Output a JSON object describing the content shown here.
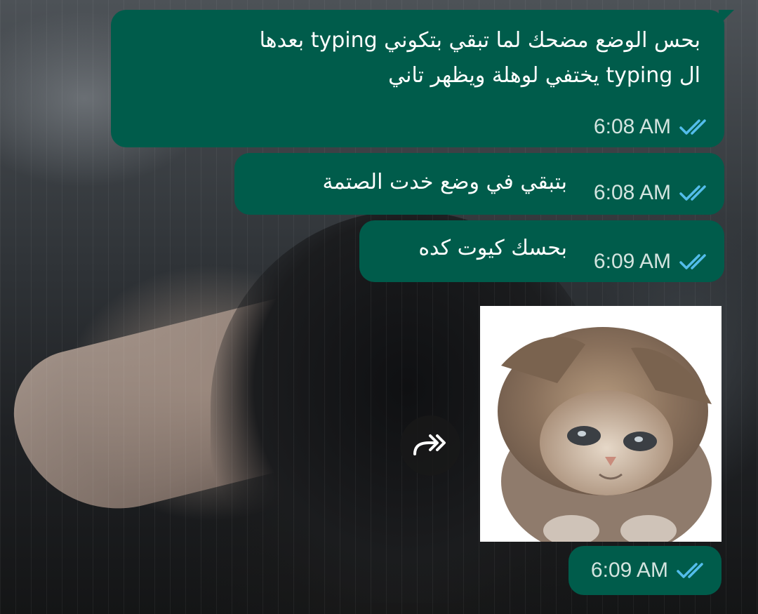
{
  "chat": {
    "messages": [
      {
        "text_lines": [
          "بحس الوضع مضحك لما تبقي بتكوني typing بعدها",
          "ال typing يختفي لوهلة ويظهر تاني"
        ],
        "time": "6:08 AM",
        "status": "read"
      },
      {
        "text": "بتبقي في وضع خدت الصتمة",
        "time": "6:08 AM",
        "status": "read"
      },
      {
        "text": "بحسك كيوت كده",
        "time": "6:09 AM",
        "status": "read"
      },
      {
        "image": "sad-kitten-sticker-photo",
        "time": "6:09 AM",
        "status": "read"
      }
    ]
  },
  "colors": {
    "outgoing_bubble": "#005c4b",
    "read_ticks": "#53bdeb",
    "timestamp": "#d3e4df"
  },
  "icons": {
    "read_status": "double-check-icon",
    "forward": "forward-icon"
  }
}
